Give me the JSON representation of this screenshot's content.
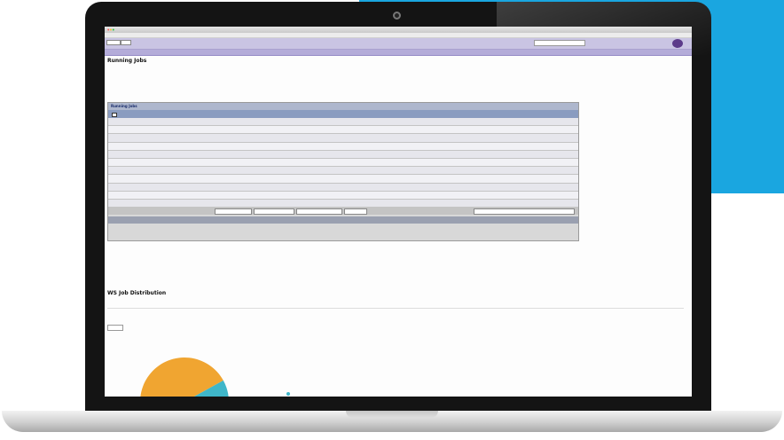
{
  "colors": {
    "accent_blue": "#1aa6e0",
    "pie_orange": "#f0a531",
    "pie_teal": "#3fb6c9",
    "nav_purple": "#b4acd9"
  },
  "window": {
    "title": ""
  },
  "bookmarks": [],
  "header": {
    "search_label": "",
    "search_placeholder": ""
  },
  "nav": {
    "items": []
  },
  "page": {
    "title": "Running Jobs",
    "subtitle": "",
    "panel_title": "Running Jobs",
    "columns": [
      "",
      "",
      "",
      "",
      "",
      "",
      "",
      "",
      "",
      "",
      "",
      "",
      ""
    ],
    "rows": [],
    "pager_text": ""
  },
  "section2": {
    "title": "WS Job Distribution",
    "subtitle": ""
  },
  "chart_data": {
    "type": "pie",
    "slices": [
      {
        "name": "",
        "value": 92,
        "color": "#f0a531"
      },
      {
        "name": "",
        "value": 8,
        "color": "#3fb6c9"
      }
    ]
  }
}
